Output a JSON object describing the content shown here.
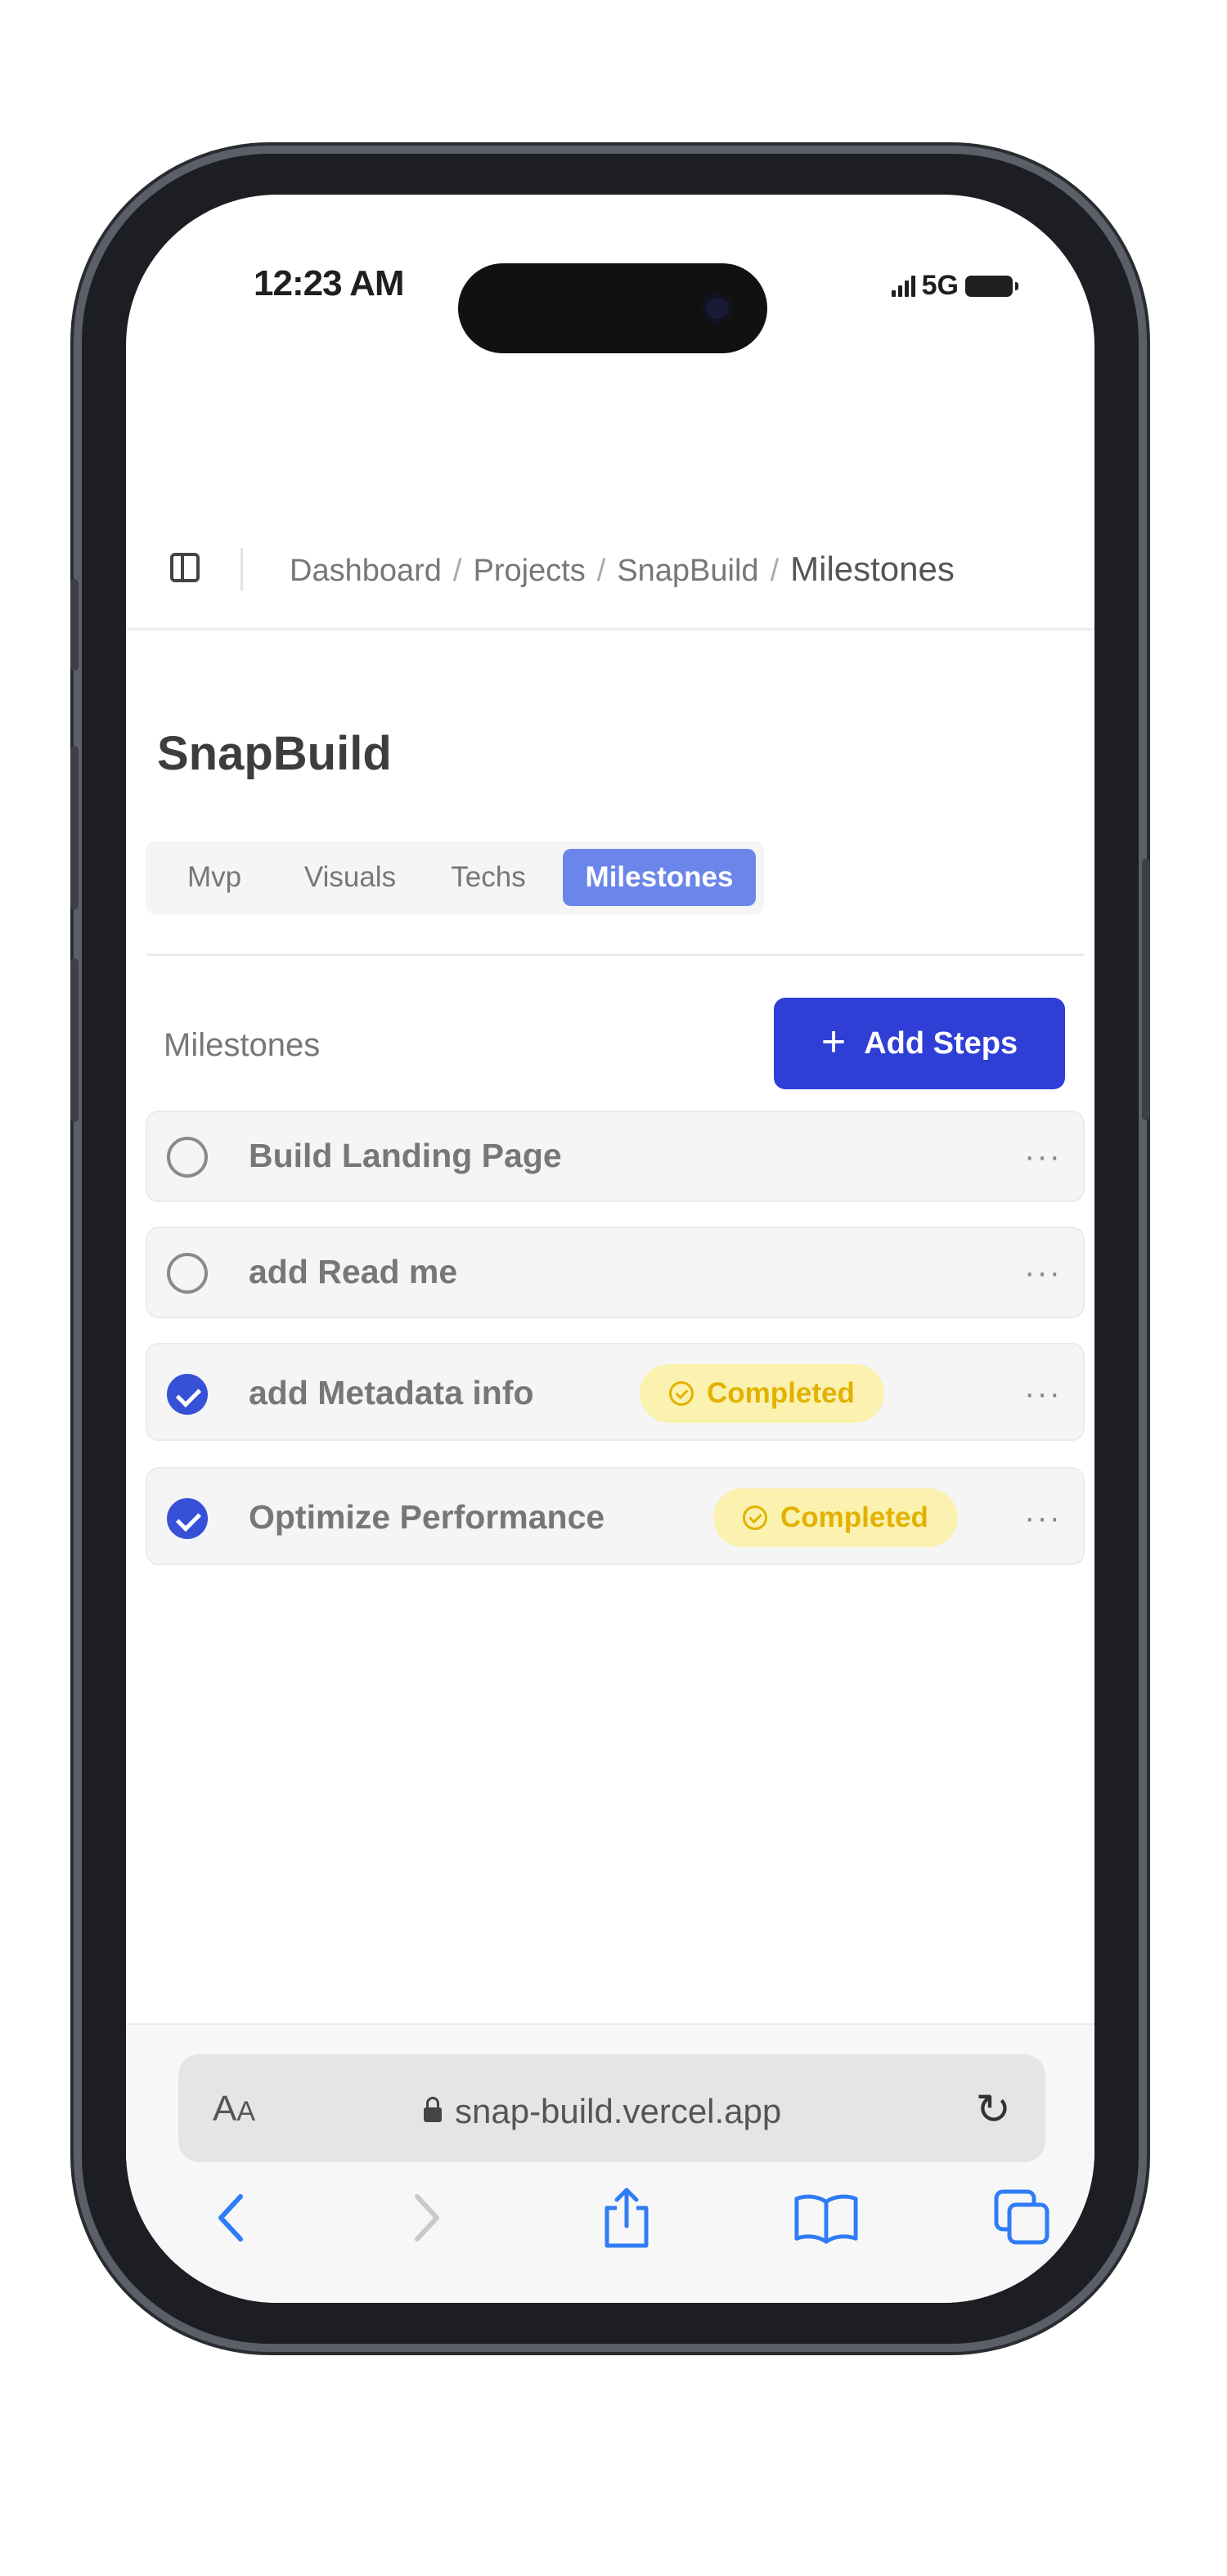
{
  "status_bar": {
    "time": "12:23 AM",
    "network": "5G"
  },
  "breadcrumb": {
    "items": [
      "Dashboard",
      "Projects",
      "SnapBuild"
    ],
    "current": "Milestones",
    "separator": "/"
  },
  "page": {
    "title": "SnapBuild"
  },
  "tabs": [
    {
      "label": "Mvp",
      "active": false
    },
    {
      "label": "Visuals",
      "active": false
    },
    {
      "label": "Techs",
      "active": false
    },
    {
      "label": "Milestones",
      "active": true
    }
  ],
  "milestones": {
    "title": "Milestones",
    "add_button_label": "Add Steps",
    "items": [
      {
        "label": "Build Landing Page",
        "completed": false,
        "badge": ""
      },
      {
        "label": "add Read me",
        "completed": false,
        "badge": ""
      },
      {
        "label": "add Metadata info",
        "completed": true,
        "badge": "Completed"
      },
      {
        "label": "Optimize Performance",
        "completed": true,
        "badge": "Completed"
      }
    ],
    "more_glyph": "···"
  },
  "browser": {
    "text_size_label": "A",
    "text_size_label_small": "A",
    "url": "snap-build.vercel.app"
  },
  "colors": {
    "accent": "#2f3fd6",
    "active_tab": "#6b86ea",
    "check": "#3651d8",
    "badge_bg": "#fbf2b0",
    "badge_text": "#e3b100",
    "safari_blue": "#2f7cf6"
  }
}
